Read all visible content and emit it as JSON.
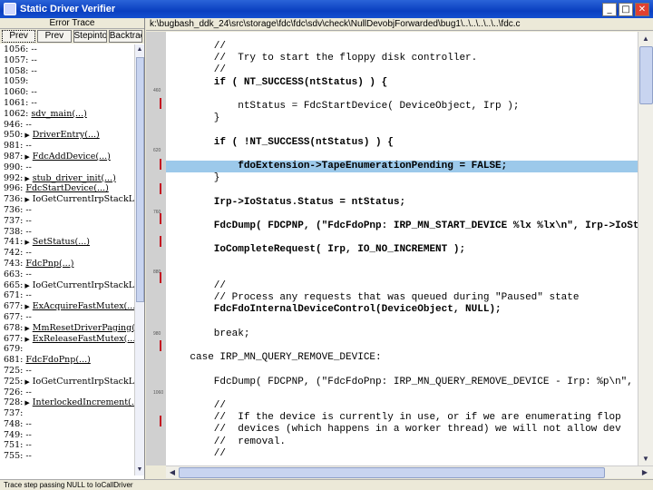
{
  "window": {
    "title": "Static Driver Verifier",
    "minimize": "_",
    "maximize": "□",
    "close": "✕"
  },
  "left_pane": {
    "header": "Error Trace",
    "nav_buttons": [
      "Prev",
      "Prev",
      "Stepinto",
      "Backtrack"
    ],
    "trace_rows": [
      {
        "num": "1056:",
        "arrow": false,
        "text": "--"
      },
      {
        "num": "1057:",
        "arrow": false,
        "text": "--"
      },
      {
        "num": "1058:",
        "arrow": false,
        "text": "--"
      },
      {
        "num": "1059:",
        "arrow": false,
        "text": ""
      },
      {
        "num": "1060:",
        "arrow": false,
        "text": "--"
      },
      {
        "num": "1061:",
        "arrow": false,
        "text": "--"
      },
      {
        "num": "1062:",
        "arrow": false,
        "text": "sdv_main(...)"
      },
      {
        "num": "946:",
        "arrow": false,
        "text": "--"
      },
      {
        "num": "950:",
        "arrow": true,
        "text": "DriverEntry(...)"
      },
      {
        "num": "981:",
        "arrow": false,
        "text": "--"
      },
      {
        "num": "987:",
        "arrow": true,
        "text": "FdcAddDevice(...)"
      },
      {
        "num": "990:",
        "arrow": false,
        "text": "--"
      },
      {
        "num": "992:",
        "arrow": true,
        "text": "stub_driver_init(...)"
      },
      {
        "num": "996:",
        "arrow": false,
        "text": "FdcStartDevice(...)"
      },
      {
        "num": "736:",
        "arrow": true,
        "text": "IoGetCurrentIrpStackLoc"
      },
      {
        "num": "736:",
        "arrow": false,
        "text": "--"
      },
      {
        "num": "737:",
        "arrow": false,
        "text": "--"
      },
      {
        "num": "738:",
        "arrow": false,
        "text": "--"
      },
      {
        "num": "741:",
        "arrow": true,
        "text": "SetStatus(...)"
      },
      {
        "num": "742:",
        "arrow": false,
        "text": "--"
      },
      {
        "num": "743:",
        "arrow": false,
        "text": "FdcPnp(...)"
      },
      {
        "num": "663:",
        "arrow": false,
        "text": "--"
      },
      {
        "num": "665:",
        "arrow": true,
        "text": "IoGetCurrentIrpStackLoc"
      },
      {
        "num": "671:",
        "arrow": false,
        "text": "--"
      },
      {
        "num": "677:",
        "arrow": true,
        "text": "ExAcquireFastMutex(...)"
      },
      {
        "num": "677:",
        "arrow": false,
        "text": "--"
      },
      {
        "num": "678:",
        "arrow": true,
        "text": "MmResetDriverPaging(...)"
      },
      {
        "num": "677:",
        "arrow": true,
        "text": "ExReleaseFastMutex(...)"
      },
      {
        "num": "679:",
        "arrow": false,
        "text": ""
      },
      {
        "num": "681:",
        "arrow": false,
        "text": "FdcFdoPnp(...)"
      },
      {
        "num": "725:",
        "arrow": false,
        "text": "--"
      },
      {
        "num": "725:",
        "arrow": true,
        "text": "IoGetCurrentIrpStackLoc"
      },
      {
        "num": "726:",
        "arrow": false,
        "text": "--"
      },
      {
        "num": "728:",
        "arrow": true,
        "text": "InterlockedIncrement(...)"
      },
      {
        "num": "737:",
        "arrow": false,
        "text": ""
      },
      {
        "num": "748:",
        "arrow": false,
        "text": "--"
      },
      {
        "num": "749:",
        "arrow": false,
        "text": "--"
      },
      {
        "num": "751:",
        "arrow": false,
        "text": "--"
      },
      {
        "num": "755:",
        "arrow": false,
        "text": "--"
      }
    ]
  },
  "path_bar": "k:\\bugbash_ddk_24\\src\\storage\\fdc\\fdc\\sdv\\check\\NullDevobjForwarded\\bug1\\..\\..\\..\\..\\..\\fdc.c",
  "gutter": {
    "numbers": [
      "460",
      "620",
      "760",
      "880",
      "980",
      "1060"
    ],
    "marks": 8
  },
  "code_lines": [
    {
      "text": "        //",
      "bold": false,
      "highlight": false
    },
    {
      "text": "        //  Try to start the floppy disk controller.",
      "bold": false,
      "highlight": false
    },
    {
      "text": "        //",
      "bold": false,
      "highlight": false
    },
    {
      "text": "        if ( NT_SUCCESS(ntStatus) ) {",
      "bold": true,
      "highlight": false
    },
    {
      "text": "",
      "bold": false,
      "highlight": false
    },
    {
      "text": "            ntStatus = FdcStartDevice( DeviceObject, Irp );",
      "bold": false,
      "highlight": false
    },
    {
      "text": "        }",
      "bold": false,
      "highlight": false
    },
    {
      "text": "",
      "bold": false,
      "highlight": false
    },
    {
      "text": "        if ( !NT_SUCCESS(ntStatus) ) {",
      "bold": true,
      "highlight": false
    },
    {
      "text": "",
      "bold": false,
      "highlight": false
    },
    {
      "text": "            fdoExtension->TapeEnumerationPending = FALSE;",
      "bold": true,
      "highlight": true
    },
    {
      "text": "        }",
      "bold": false,
      "highlight": false
    },
    {
      "text": "",
      "bold": false,
      "highlight": false
    },
    {
      "text": "        Irp->IoStatus.Status = ntStatus;",
      "bold": true,
      "highlight": false
    },
    {
      "text": "",
      "bold": false,
      "highlight": false
    },
    {
      "text": "        FdcDump( FDCPNP, (\"FdcFdoPnp: IRP_MN_START_DEVICE %lx %lx\\n\", Irp->IoStatus",
      "bold": true,
      "highlight": false
    },
    {
      "text": "",
      "bold": false,
      "highlight": false
    },
    {
      "text": "        IoCompleteRequest( Irp, IO_NO_INCREMENT );",
      "bold": true,
      "highlight": false
    },
    {
      "text": "",
      "bold": false,
      "highlight": false
    },
    {
      "text": "",
      "bold": false,
      "highlight": false
    },
    {
      "text": "        //",
      "bold": false,
      "highlight": false
    },
    {
      "text": "        // Process any requests that was queued during \"Paused\" state",
      "bold": false,
      "highlight": false
    },
    {
      "text": "        FdcFdoInternalDeviceControl(DeviceObject, NULL);",
      "bold": true,
      "highlight": false
    },
    {
      "text": "",
      "bold": false,
      "highlight": false
    },
    {
      "text": "        break;",
      "bold": false,
      "highlight": false
    },
    {
      "text": "",
      "bold": false,
      "highlight": false
    },
    {
      "text": "    case IRP_MN_QUERY_REMOVE_DEVICE:",
      "bold": false,
      "highlight": false
    },
    {
      "text": "",
      "bold": false,
      "highlight": false
    },
    {
      "text": "        FdcDump( FDCPNP, (\"FdcFdoPnp: IRP_MN_QUERY_REMOVE_DEVICE - Irp: %p\\n\", Irp",
      "bold": false,
      "highlight": false
    },
    {
      "text": "",
      "bold": false,
      "highlight": false
    },
    {
      "text": "        //",
      "bold": false,
      "highlight": false
    },
    {
      "text": "        //  If the device is currently in use, or if we are enumerating flop",
      "bold": false,
      "highlight": false
    },
    {
      "text": "        //  devices (which happens in a worker thread) we will not allow dev",
      "bold": false,
      "highlight": false
    },
    {
      "text": "        //  removal.",
      "bold": false,
      "highlight": false
    },
    {
      "text": "        //",
      "bold": false,
      "highlight": false
    }
  ],
  "statusbar": "Trace step passing NULL to IoCallDriver"
}
